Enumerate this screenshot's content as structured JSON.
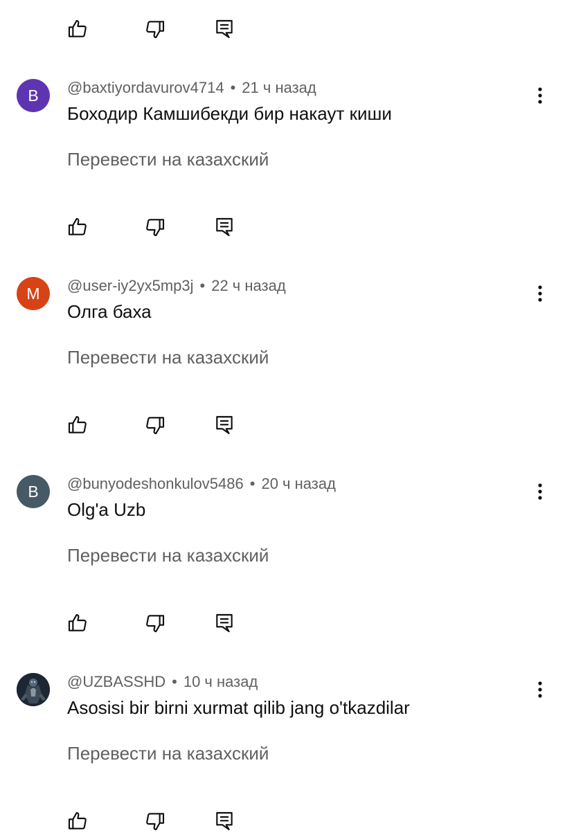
{
  "icons": {
    "like": "thumbs-up-icon",
    "dislike": "thumbs-down-icon",
    "reply": "reply-icon",
    "more": "more-vertical-icon"
  },
  "comments": [
    {
      "avatar_letter": "B",
      "avatar_color": "#5e35b1",
      "author": "@baxtiyordavurov4714",
      "separator": "•",
      "time": "21 ч назад",
      "text": "Боходир Камшибекди бир накаут киши",
      "translate_label": "Перевести на казахский"
    },
    {
      "avatar_letter": "M",
      "avatar_color": "#d84315",
      "author": "@user-iy2yx5mp3j",
      "separator": "•",
      "time": "22 ч назад",
      "text": "Олга баха",
      "translate_label": "Перевести на казахский"
    },
    {
      "avatar_letter": "B",
      "avatar_color": "#455a64",
      "author": "@bunyodeshonkulov5486",
      "separator": "•",
      "time": "20 ч назад",
      "text": "Olg'a Uzb",
      "translate_label": "Перевести на казахский"
    },
    {
      "avatar_letter": "",
      "avatar_color": "#1c2733",
      "author": "@UZBASSHD",
      "separator": "•",
      "time": "10 ч назад",
      "text": "Asosisi bir birni xurmat qilib jang o'tkazdilar",
      "translate_label": "Перевести на казахский"
    }
  ]
}
